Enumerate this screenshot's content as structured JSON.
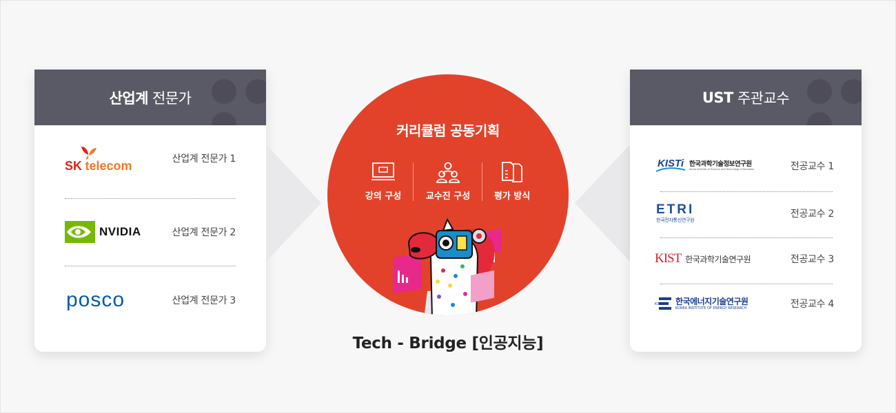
{
  "industry": {
    "title_bold": "산업계",
    "title_rest": "전문가",
    "items": [
      {
        "logo": "SK telecom",
        "logo_sk": "SK",
        "logo_word": "telecom",
        "label": "산업계 전문가 1"
      },
      {
        "logo": "NVIDIA",
        "logo_text": "NVIDIA",
        "label": "산업계 전문가 2"
      },
      {
        "logo": "POSCO",
        "logo_text": "posco",
        "label": "산업계 전문가 3"
      }
    ]
  },
  "center": {
    "title": "커리큘럼 공동기획",
    "features": [
      {
        "icon": "monitor-icon",
        "label": "강의 구성"
      },
      {
        "icon": "people-icon",
        "label": "교수진 구성"
      },
      {
        "icon": "documents-icon",
        "label": "평가 방식"
      }
    ],
    "caption": "Tech - Bridge [인공지능]"
  },
  "ust": {
    "title_bold": "UST",
    "title_rest": "주관교수",
    "items": [
      {
        "logo_mark": "KISTi",
        "logo_name": "한국과학기술정보연구원",
        "logo_sub": "Korea Institute of Science and Technology Information",
        "label": "전공교수 1"
      },
      {
        "logo_mark": "ETRI",
        "logo_name": "한국전자통신연구원",
        "label": "전공교수 2"
      },
      {
        "logo_mark": "KIST",
        "logo_name": "한국과학기술연구원",
        "label": "전공교수 3"
      },
      {
        "logo_mark": "KIER",
        "logo_name": "한국에너지기술연구원",
        "logo_sub": "KOREA INSTITUTE OF ENERGY RESEARCH",
        "label": "전공교수 4"
      }
    ]
  },
  "colors": {
    "circle": "#e3422a",
    "header": "#5a5966",
    "sk_red": "#e2231a",
    "sk_orange": "#f47725",
    "nvidia_green": "#76b900",
    "posco_blue": "#005bac",
    "etri_blue": "#1d4e9e",
    "kist_red": "#d6232a",
    "kisti_blue": "#1a3f8f"
  }
}
